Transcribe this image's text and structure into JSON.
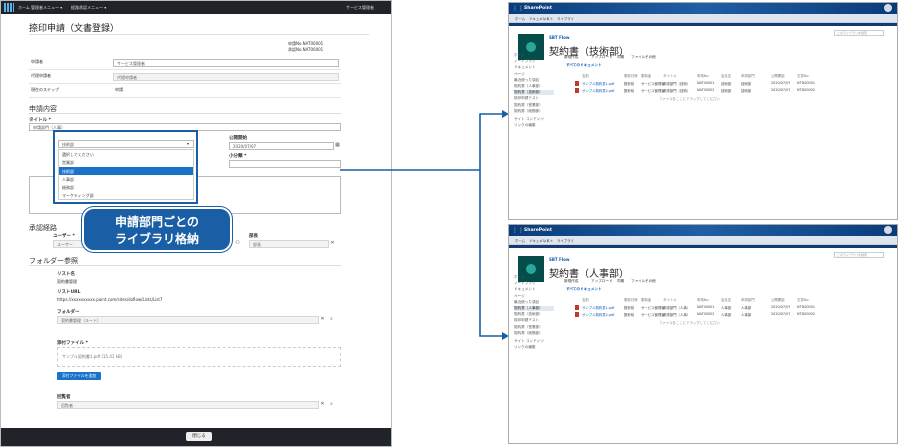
{
  "form": {
    "topbar": {
      "items": [
        "ホーム",
        "管理者メニュー ▾",
        "経路承認メニュー ▾"
      ],
      "right": "サービス管理者"
    },
    "title": "捺印申請（文書登録）",
    "app_no_label": "申請No.",
    "app_no": "NAT00001",
    "approval_no_label": "承認No.",
    "approval_no": "NAT00001",
    "info_rows": [
      {
        "k": "申請者",
        "v": "サービス管理者"
      },
      {
        "k": "代理申請者",
        "v": "代理申請者"
      },
      {
        "k": "現在のステップ",
        "v": "申請"
      }
    ],
    "section1": "申請内容",
    "title_label": "タイトル *",
    "title_value": "申請部門（人事）",
    "dept_label": "申請部門 *",
    "dept_value": "技術部",
    "dropdown_items": [
      "選択してください",
      "営業部",
      "技術部",
      "人事部",
      "総務部",
      "マーケティング部"
    ],
    "dropdown_selected": 2,
    "date_label": "公開開始",
    "date_value": "2020/07/07",
    "amount_label": "小分類 *",
    "callout": [
      "申請部門ごとの",
      "ライブラリ格納"
    ],
    "section2": "承認経路",
    "user_label": "ユーザー *",
    "user_ph": "ユーザー",
    "role_label": "部長",
    "role_ph": "部長",
    "section3": "フォルダー参照",
    "list_label": "リスト名",
    "list_value": "契約書管理",
    "url_label": "リストURL",
    "url_value": "https://xxxxxxxxxx.point.com/sites/sbflow/Lists/List7",
    "folder_label": "フォルダー",
    "folder_value": "契約書管理（ルート）",
    "attach_label": "添付ファイル *",
    "attach_value": "サンプル契約書1.pdf (15.41 kB)",
    "attach_button": "添付ファイルを追加",
    "approver_label": "回覧者",
    "approver_value": "回覧者",
    "close_button": "閉じる"
  },
  "sharepoint_windows": [
    {
      "suite": "SharePoint",
      "site": "SBT Flow",
      "title": "契約書（技術部）",
      "tabs": [
        "ホーム",
        "ドキュメント",
        "リスト",
        "ライブラリ"
      ],
      "nav": [
        "ホーム",
        "ノートブック",
        "ドキュメント",
        "ページ",
        "最近使った項目",
        "契約書（人事部）",
        "契約書（技術部）",
        "捺印申請テスト",
        "契約書（営業部）",
        "契約書（総務部）",
        "サイト コンテンツ",
        "リンクの編集"
      ],
      "commands": [
        "新規作成",
        "アップロード",
        "同期",
        "ファイル",
        "その他"
      ],
      "view": "すべてのドキュメント",
      "search": "このライブラリを検索",
      "headers": [
        "名前",
        "更新日時",
        "更新者",
        "タイトル",
        "申請No.",
        "会社名",
        "申請部門",
        "公開開始",
        "文書No."
      ],
      "rows": [
        {
          "name": "サンプル契約書1.pdf",
          "date": "数秒前",
          "user": "サービス管理者",
          "title": "申請部門（技術）",
          "no": "NAT00001",
          "company": "技術部",
          "dept": "技術部",
          "open": "2020/07/07",
          "doc": "NTD00001"
        },
        {
          "name": "サンプル契約書2.pdf",
          "date": "数秒前",
          "user": "サービス管理者",
          "title": "申請部門（技術）",
          "no": "NAT00002",
          "company": "技術部",
          "dept": "技術部",
          "open": "2020/07/07",
          "doc": "NTD00002"
        }
      ],
      "drop": "ファイルをここにドラッグしてください"
    },
    {
      "suite": "SharePoint",
      "site": "SBT Flow",
      "title": "契約書（人事部）",
      "tabs": [
        "ホーム",
        "ドキュメント",
        "リスト",
        "ライブラリ"
      ],
      "nav": [
        "ホーム",
        "ノートブック",
        "ドキュメント",
        "ページ",
        "最近使った項目",
        "契約書（人事部）",
        "契約書（技術部）",
        "捺印申請テスト",
        "契約書（営業部）",
        "契約書（総務部）",
        "サイト コンテンツ",
        "リンクの編集"
      ],
      "commands": [
        "新規作成",
        "アップロード",
        "同期",
        "ファイル",
        "その他"
      ],
      "view": "すべてのドキュメント",
      "search": "このライブラリを検索",
      "headers": [
        "名前",
        "更新日時",
        "更新者",
        "タイトル",
        "申請No.",
        "会社名",
        "申請部門",
        "公開開始",
        "文書No."
      ],
      "rows": [
        {
          "name": "サンプル契約書1.pdf",
          "date": "数秒前",
          "user": "サービス管理者",
          "title": "申請部門（人事）",
          "no": "NAT00001",
          "company": "人事部",
          "dept": "人事部",
          "open": "2020/07/07",
          "doc": "NTD00001"
        },
        {
          "name": "サンプル契約書2.pdf",
          "date": "数秒前",
          "user": "サービス管理者",
          "title": "申請部門（人事）",
          "no": "NAT00002",
          "company": "人事部",
          "dept": "人事部",
          "open": "2020/07/07",
          "doc": "NTD00002"
        }
      ],
      "drop": "ファイルをここにドラッグしてください"
    }
  ],
  "colors": {
    "accent": "#1a5fa6",
    "topbar": "#20242a",
    "sp_bar": "#1f5fa5"
  }
}
